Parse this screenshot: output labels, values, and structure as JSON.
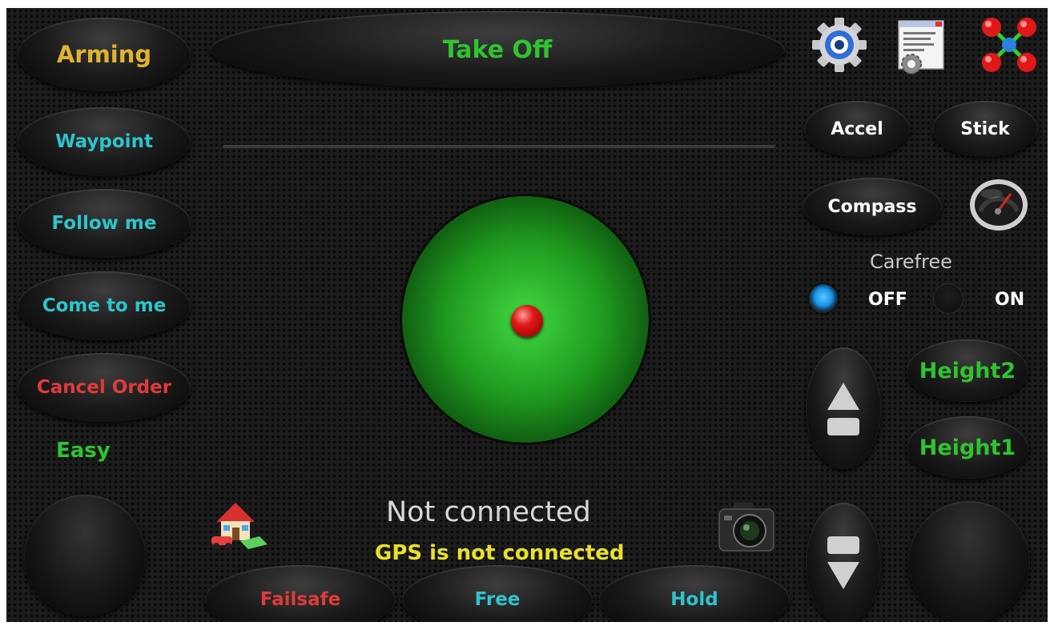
{
  "colors": {
    "yellow": "#e0b430",
    "cyan": "#2fc4cc",
    "red": "#e03a3a",
    "green": "#2fc42f",
    "white": "#ffffff",
    "gps_yellow": "#e8e02a"
  },
  "left_panel": {
    "arming": "Arming",
    "waypoint": "Waypoint",
    "follow_me": "Follow me",
    "come_to_me": "Come to me",
    "cancel_order": "Cancel Order",
    "mode": "Easy"
  },
  "top": {
    "take_off": "Take Off"
  },
  "right_panel": {
    "icons": [
      "settings-gear-icon",
      "config-document-icon",
      "quadcopter-icon",
      "speedometer-icon"
    ],
    "accel": "Accel",
    "stick": "Stick",
    "compass": "Compass",
    "carefree": {
      "title": "Carefree",
      "off_label": "OFF",
      "on_label": "ON",
      "selected": "OFF"
    },
    "height2": "Height2",
    "height1": "Height1"
  },
  "status": {
    "connection": "Not connected",
    "gps": "GPS is not connected"
  },
  "bottom": {
    "failsafe": "Failsafe",
    "free": "Free",
    "hold": "Hold"
  },
  "icons": [
    "home-icon",
    "camera-icon",
    "arrow-up-icon",
    "arrow-down-icon"
  ]
}
